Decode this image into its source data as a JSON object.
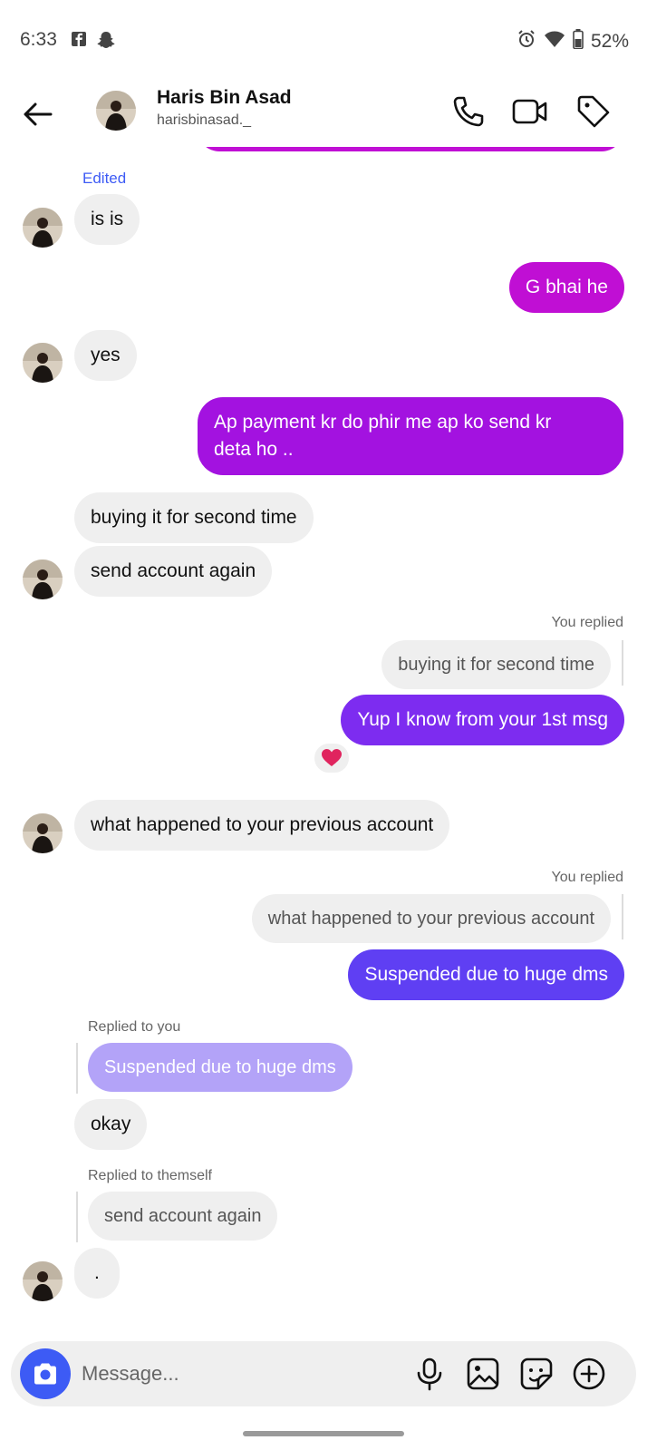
{
  "status_bar": {
    "time": "6:33",
    "battery": "52%"
  },
  "header": {
    "name": "Haris Bin Asad",
    "handle": "harisbinasad._"
  },
  "messages": {
    "edited_label": "Edited",
    "m1": "is is",
    "m2": "G bhai he",
    "m3": "yes",
    "m4_line1": "Ap payment kr do phir me ap ko send kr",
    "m4_line2": "deta ho ..",
    "m5": "buying it for second time",
    "m6": "send account again",
    "you_replied_1": "You replied",
    "quote1": "buying it for second time",
    "m7": "Yup I know from your 1st msg",
    "reaction": "❤️",
    "m8": "what happened to your previous account",
    "you_replied_2": "You replied",
    "quote2": "what happened to your previous account",
    "m9": "Suspended due to huge dms",
    "replied_to_you": "Replied to you",
    "quote3": "Suspended due to huge dms",
    "m10": "okay",
    "replied_to_themself": "Replied to themself",
    "quote4": "send account again",
    "m11": "."
  },
  "composer": {
    "placeholder": "Message..."
  },
  "colors": {
    "out_top": "#c00fd4",
    "out_mid": "#a312e0",
    "out_low": "#7d2cf0",
    "out_bottom": "#5f3ff3",
    "quote_purple": "#b3a3f8",
    "camera": "#3d5bf5"
  }
}
